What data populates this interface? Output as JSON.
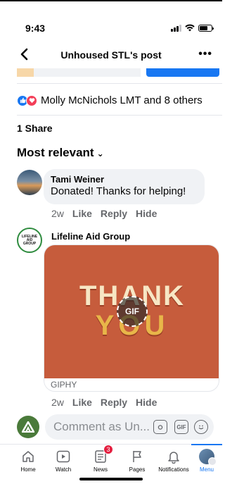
{
  "status_bar": {
    "time": "9:43"
  },
  "nav": {
    "back_icon": "chevron-left-icon",
    "title": "Unhoused STL's post",
    "more_icon": "ellipsis-icon",
    "more_glyph": "•••"
  },
  "reactions": {
    "text": "Molly McNichols LMT and 8 others"
  },
  "shares": {
    "text": "1 Share"
  },
  "sort": {
    "label": "Most relevant"
  },
  "comments": [
    {
      "author": "Tami Weiner",
      "text": "Donated! Thanks for helping!",
      "time": "2w",
      "like": "Like",
      "reply": "Reply",
      "hide": "Hide"
    },
    {
      "author": "Lifeline Aid Group",
      "avatar_lines": [
        "LIFELINE",
        "AID",
        "GROUP"
      ],
      "gif": {
        "line1": "THANK",
        "line2": "YOU",
        "badge": "GIF",
        "source": "GIPHY"
      },
      "time": "2w",
      "like": "Like",
      "reply": "Reply",
      "hide": "Hide"
    }
  ],
  "composer": {
    "placeholder": "Comment as Un...",
    "gif_label": "GIF"
  },
  "tabs": [
    {
      "label": "Home",
      "icon": "home-icon"
    },
    {
      "label": "Watch",
      "icon": "play-icon"
    },
    {
      "label": "News",
      "icon": "news-icon",
      "badge": "3"
    },
    {
      "label": "Pages",
      "icon": "flag-icon"
    },
    {
      "label": "Notifications",
      "icon": "bell-icon"
    },
    {
      "label": "Menu",
      "icon": "menu-avatar-icon"
    }
  ],
  "colors": {
    "accent": "#1877f2",
    "badge": "#e41e3f",
    "bubble": "#f0f2f5",
    "secondary_text": "#65676b"
  }
}
